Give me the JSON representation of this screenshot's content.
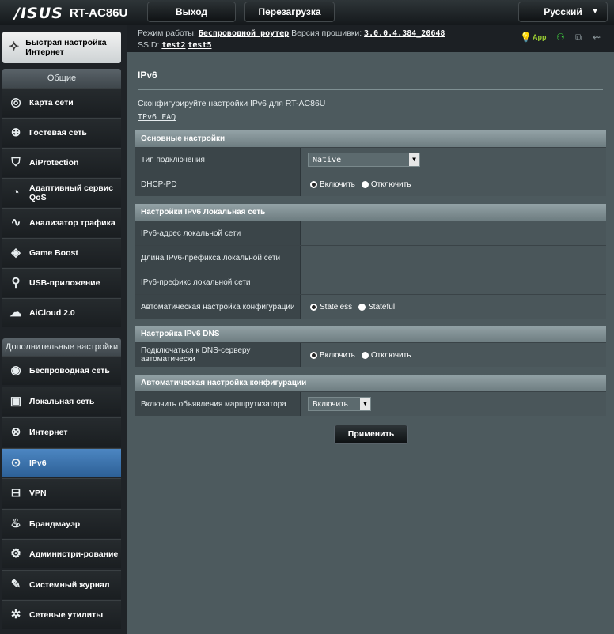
{
  "header": {
    "logo": "/ISUS",
    "model": "RT-AC86U",
    "logout": "Выход",
    "reboot": "Перезагрузка",
    "language": "Русский",
    "lang_arrow": "▼"
  },
  "info": {
    "mode_label": "Режим работы:",
    "mode_value": "Беспроводной роутер",
    "fw_label": "Версия прошивки:",
    "fw_value": "3.0.0.4.384_20648",
    "ssid_label": "SSID:",
    "ssid_1": "test2",
    "ssid_2": "test5",
    "app_label": "App"
  },
  "sidebar": {
    "quick": "Быстрая настройка Интернет",
    "general_header": "Общие",
    "general": [
      {
        "label": "Карта сети",
        "icon": "network-map-icon"
      },
      {
        "label": "Гостевая сеть",
        "icon": "guest-network-icon"
      },
      {
        "label": "AiProtection",
        "icon": "shield-icon"
      },
      {
        "label": "Адаптивный сервис QoS",
        "icon": "gauge-icon"
      },
      {
        "label": "Анализатор трафика",
        "icon": "traffic-icon"
      },
      {
        "label": "Game Boost",
        "icon": "gamepad-icon"
      },
      {
        "label": "USB-приложение",
        "icon": "usb-icon"
      },
      {
        "label": "AiCloud 2.0",
        "icon": "cloud-icon"
      }
    ],
    "advanced_header": "Дополнительные настройки",
    "advanced": [
      {
        "label": "Беспроводная сеть",
        "icon": "wifi-icon"
      },
      {
        "label": "Локальная сеть",
        "icon": "lan-icon"
      },
      {
        "label": "Интернет",
        "icon": "globe-icon"
      },
      {
        "label": "IPv6",
        "icon": "ipv6-icon"
      },
      {
        "label": "VPN",
        "icon": "vpn-icon"
      },
      {
        "label": "Брандмауэр",
        "icon": "firewall-icon"
      },
      {
        "label": "Администри-рование",
        "icon": "admin-icon"
      },
      {
        "label": "Системный журнал",
        "icon": "log-icon"
      },
      {
        "label": "Сетевые утилиты",
        "icon": "tools-icon"
      }
    ]
  },
  "main": {
    "title": "IPv6",
    "description": "Сконфигурируйте настройки IPv6 для RT-AC86U",
    "faq": "IPv6 FAQ",
    "basic": {
      "header": "Основные настройки",
      "conn_label": "Тип подключения",
      "conn_value": "Native",
      "dhcppd_label": "DHCP-PD",
      "enable": "Включить",
      "disable": "Отключить"
    },
    "lan": {
      "header": "Настройки IPv6 Локальная сеть",
      "addr_label": "IPv6-адрес локальной сети",
      "prefixlen_label": "Длина IPv6-префикса локальной сети",
      "prefix_label": "IPv6-префикс локальной сети",
      "autoconf_label": "Автоматическая настройка конфигурации",
      "stateless": "Stateless",
      "stateful": "Stateful"
    },
    "dns": {
      "header": "Настройка IPv6 DNS",
      "auto_label": "Подключаться к DNS-серверу автоматически",
      "enable": "Включить",
      "disable": "Отключить"
    },
    "autoconf": {
      "header": "Автоматическая настройка конфигурации",
      "ra_label": "Включить объявления маршрутизатора",
      "ra_value": "Включить"
    },
    "apply": "Применить"
  }
}
